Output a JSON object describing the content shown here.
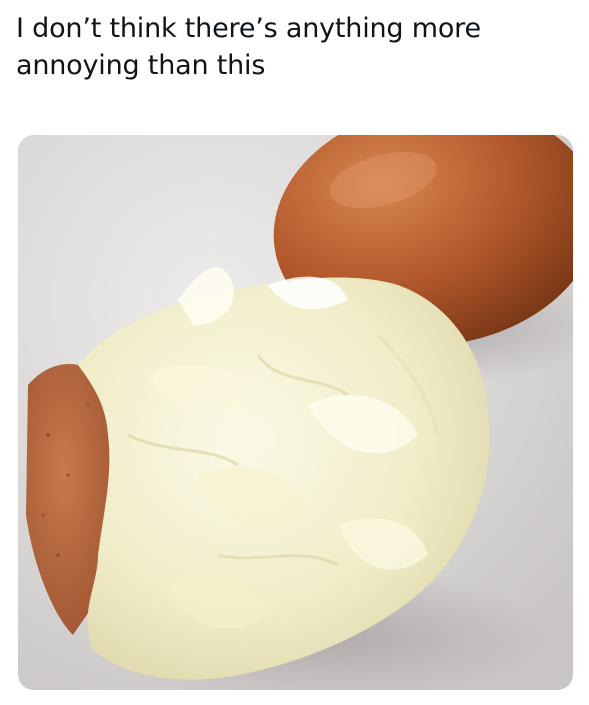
{
  "post": {
    "text": "I don’t think there’s anything more annoying than this"
  },
  "media": {
    "alt": "Badly peeled hard-boiled egg beside a whole brown egg",
    "colors": {
      "background": "#dcd9d9",
      "shell": "#b8643a",
      "egg_white": "#f3f0d2"
    }
  }
}
